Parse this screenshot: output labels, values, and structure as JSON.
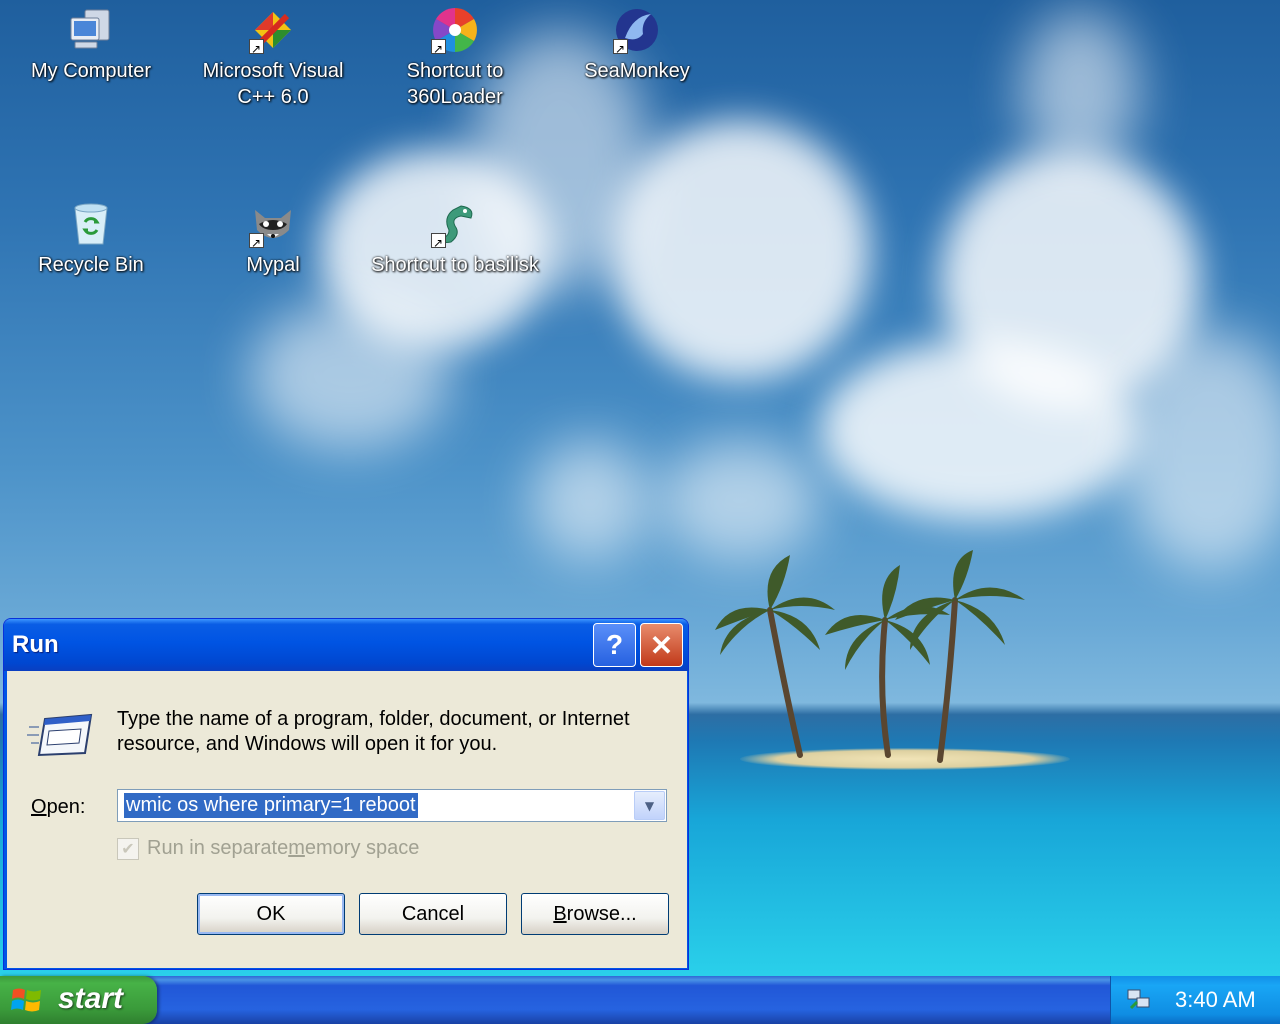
{
  "desktop": {
    "icons": [
      {
        "label": "My Computer",
        "icon": "my-computer-icon"
      },
      {
        "label": "Microsoft Visual C++ 6.0",
        "icon": "visual-cpp-icon"
      },
      {
        "label": "Shortcut to 360Loader",
        "icon": "360loader-icon"
      },
      {
        "label": "SeaMonkey",
        "icon": "seamonkey-icon"
      },
      {
        "label": "Recycle Bin",
        "icon": "recycle-bin-icon"
      },
      {
        "label": "Mypal",
        "icon": "mypal-icon"
      },
      {
        "label": "Shortcut to basilisk",
        "icon": "basilisk-icon"
      }
    ]
  },
  "run_dialog": {
    "title": "Run",
    "help_label": "?",
    "close_label": "✕",
    "description": "Type the name of a program, folder, document, or Internet resource, and Windows will open it for you.",
    "open_label_prefix": "O",
    "open_label_rest": "pen:",
    "open_value": "wmic os where primary=1 reboot",
    "separate_memory_prefix": "Run in separate ",
    "separate_memory_accel": "m",
    "separate_memory_rest": "emory space",
    "separate_memory_checked": true,
    "ok_label": "OK",
    "cancel_label": "Cancel",
    "browse_accel": "B",
    "browse_rest": "rowse..."
  },
  "taskbar": {
    "start_label": "start",
    "clock": "3:40 AM"
  },
  "colors": {
    "title_bar": "#0054e3",
    "dialog_bg": "#ece9d8",
    "selection": "#316ac5",
    "start_green": "#3a9a3a",
    "taskbar_blue": "#2663e0"
  }
}
